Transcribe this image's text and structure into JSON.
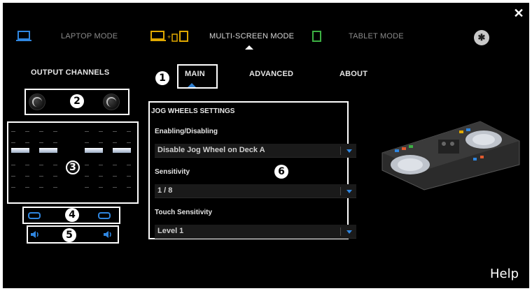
{
  "window": {
    "close_glyph": "✕"
  },
  "modes": [
    {
      "label": "LAPTOP MODE",
      "icon": "laptop-icon",
      "active": false
    },
    {
      "label": "MULTI-SCREEN MODE",
      "icon": "multi-screen-icon",
      "active": true
    },
    {
      "label": "TABLET MODE",
      "icon": "tablet-icon",
      "active": false
    }
  ],
  "bluetooth": {
    "icon": "bluetooth-icon",
    "glyph": "✱"
  },
  "output_channels": {
    "title": "OUTPUT CHANNELS",
    "callouts": {
      "knobs": "2",
      "faders": "3",
      "links": "4",
      "speakers": "5"
    }
  },
  "tabs": [
    {
      "label": "MAIN",
      "active": true,
      "callout": "1"
    },
    {
      "label": "ADVANCED",
      "active": false
    },
    {
      "label": "ABOUT",
      "active": false
    }
  ],
  "jog_wheel_settings": {
    "title": "JOG WHEELS SETTINGS",
    "callout": "6",
    "enabling_label": "Enabling/Disabling",
    "enabling_value": "Disable Jog Wheel on Deck A",
    "sensitivity_label": "Sensitivity",
    "sensitivity_value": "1 / 8",
    "touch_label": "Touch Sensitivity",
    "touch_value": "Level 1"
  },
  "help_label": "Help",
  "colors": {
    "accent": "#2f86e0",
    "active_mode": "#e0a800",
    "tablet": "#3cb043",
    "background": "#000000"
  }
}
